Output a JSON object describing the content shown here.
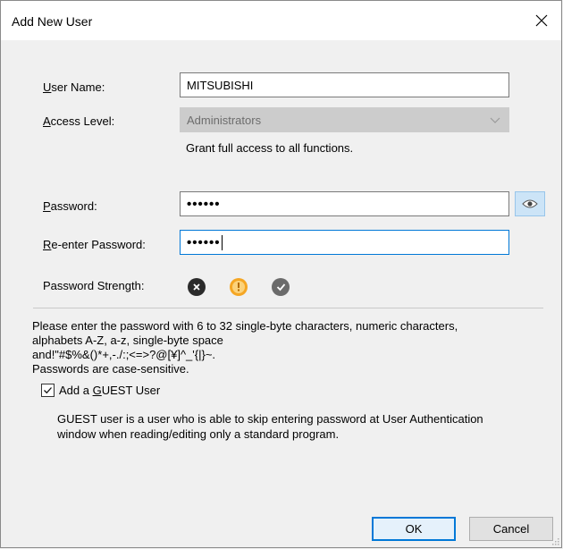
{
  "window": {
    "title": "Add New User",
    "close_glyph": "✕"
  },
  "form": {
    "user_name": {
      "label_accel": "U",
      "label_rest": "ser Name:",
      "value": "MITSUBISHI"
    },
    "access_level": {
      "label_accel": "A",
      "label_rest": "ccess Level:",
      "selected": "Administrators",
      "description": "Grant full access to all functions."
    },
    "password": {
      "label_accel": "P",
      "label_rest": "assword:",
      "masked_value": "••••••"
    },
    "reenter_password": {
      "label_accel": "R",
      "label_rest": "e-enter Password:",
      "masked_value": "••••••"
    },
    "password_strength": {
      "label": "Password Strength:"
    }
  },
  "note": "Please enter the password with 6 to 32 single-byte characters, numeric characters,\nalphabets A-Z, a-z, single-byte space\nand!\"#$%&()*+,-./:;<=>?@[¥]^_'{|}~.\nPasswords are case-sensitive.",
  "guest": {
    "checked": true,
    "label_pre": "Add a ",
    "label_accel": "G",
    "label_post": "UEST User",
    "description": "GUEST user is a user who is able to skip entering password at User Authentication\nwindow when reading/editing only a standard program."
  },
  "buttons": {
    "ok": "OK",
    "cancel": "Cancel"
  },
  "icons": {
    "close": "close-icon",
    "show_password": "eye-icon",
    "dropdown": "chevron-down-icon",
    "strength_weak": "x-circle-icon",
    "strength_medium": "exclamation-circle-icon",
    "strength_strong": "check-circle-icon",
    "checkbox": "checkmark-icon"
  },
  "colors": {
    "accent": "#0078d7",
    "eye_button_bg": "#cce4f7",
    "disabled_field_bg": "#cccccc",
    "strength_weak": "#2b2b2b",
    "strength_medium": "#f5a623",
    "strength_strong": "#6b6b6b"
  }
}
